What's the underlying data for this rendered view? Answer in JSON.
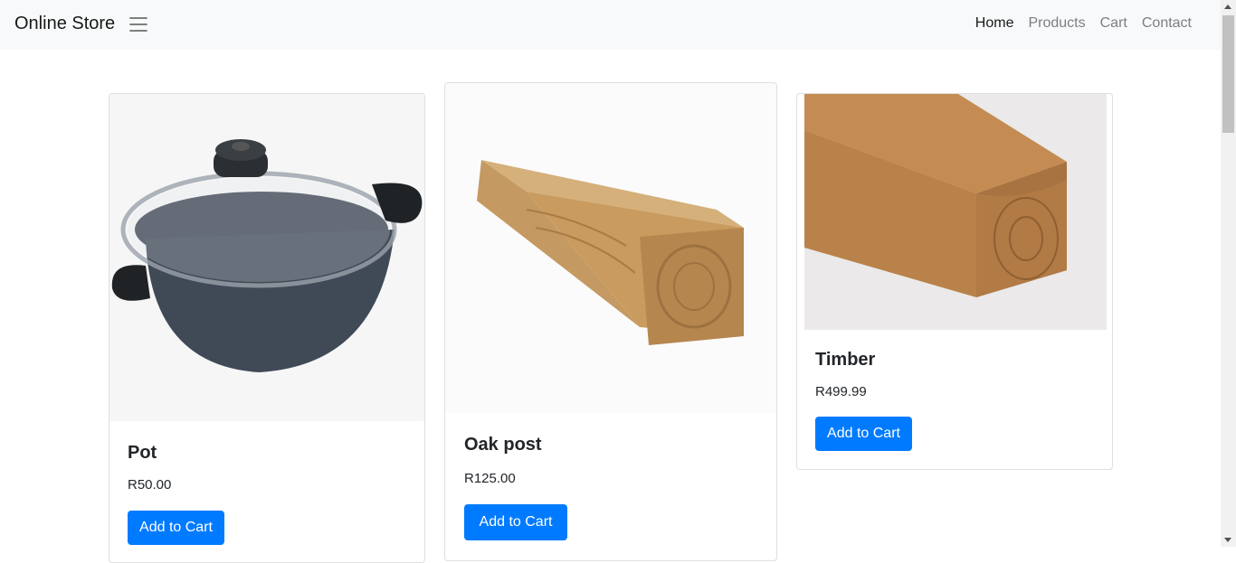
{
  "navbar": {
    "brand": "Online Store",
    "links": [
      {
        "label": "Home",
        "active": true
      },
      {
        "label": "Products",
        "active": false
      },
      {
        "label": "Cart",
        "active": false
      },
      {
        "label": "Contact",
        "active": false
      }
    ]
  },
  "products": [
    {
      "name": "Pot",
      "price": "R50.00",
      "button": "Add to Cart",
      "image": "pot-image"
    },
    {
      "name": "Oak post",
      "price": "R125.00",
      "button": "Add to Cart",
      "image": "oak-post-image"
    },
    {
      "name": "Timber",
      "price": "R499.99",
      "button": "Add to Cart",
      "image": "timber-image"
    }
  ],
  "colors": {
    "primary": "#007bff",
    "navbar_bg": "#f8f9fa"
  }
}
